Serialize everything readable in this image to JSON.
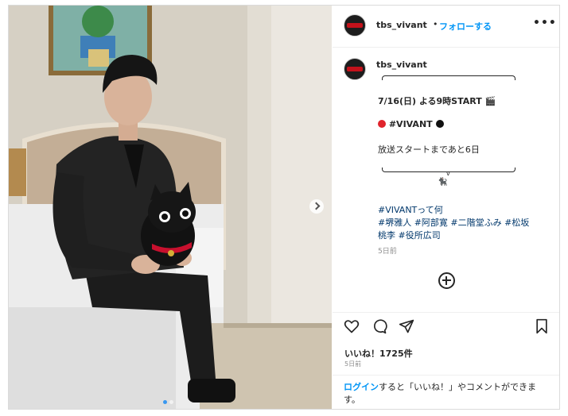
{
  "post": {
    "username": "tbs_vivant",
    "dot": "•",
    "follow_label": "フォローする",
    "more_label": "•••",
    "caption": {
      "username": "tbs_vivant",
      "line1": "7/16(日) よる9時START 🎬",
      "line2": "#VIVANT",
      "line3": "放送スタートまであと6日",
      "brace_mark": "v",
      "emoji_cat": "🐈‍⬛",
      "tags_line1": "#VIVANTって何",
      "tags_line2": "#堺雅人 #阿部寛 #二階堂ふみ #松坂",
      "tags_line3": "桃李 #役所広司",
      "time": "5日前"
    },
    "likes": "いいね！1725件",
    "time": "5日前",
    "login_link": "ログイン",
    "login_rest": "すると「いいね！」やコメントができます。"
  },
  "colors": {
    "accent": "#0095f6",
    "hashtag": "#00376b",
    "red_circle": "#e0242c",
    "black_circle": "#111111",
    "logo_red": "#c4121b"
  },
  "icons": [
    "heart-icon",
    "comment-icon",
    "share-icon",
    "bookmark-icon",
    "add-comment-icon",
    "chevron-right-icon"
  ]
}
